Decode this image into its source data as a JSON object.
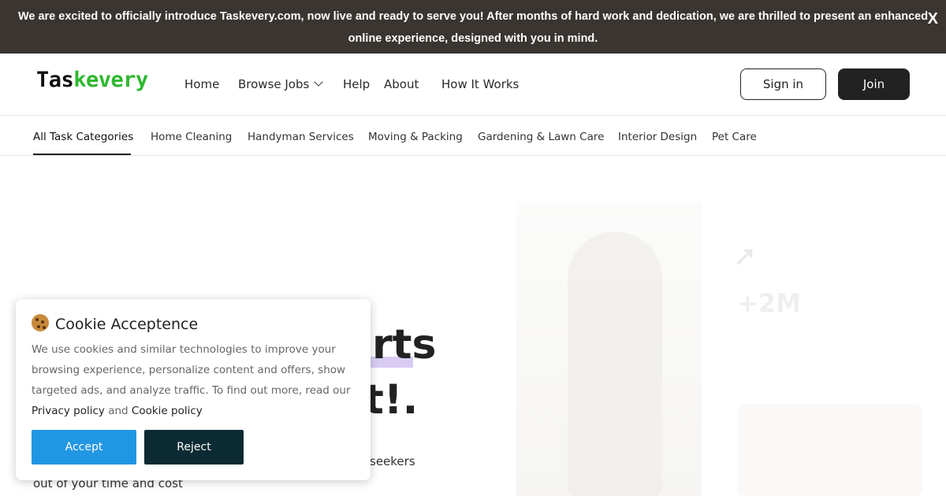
{
  "announcement": {
    "text": "We are excited to officially introduce Taskevery.com, now live and ready to serve you! After months of hard work and dedication, we are thrilled to present an enhanced online experience, designed with you in mind.",
    "close_label": "X"
  },
  "header": {
    "logo_part1": "Tas",
    "logo_part2": "kevery",
    "nav": {
      "home": "Home",
      "browse_jobs": "Browse Jobs",
      "help": "Help",
      "about": "About",
      "how_it_works": "How It Works"
    },
    "sign_in": "Sign in",
    "join": "Join"
  },
  "categories": [
    "All Task Categories",
    "Home Cleaning",
    "Handyman Services",
    "Moving & Packing",
    "Gardening & Lawn Care",
    "Interior Design",
    "Pet Care"
  ],
  "hero": {
    "title_line1_visible": "rts",
    "title_line2_visible": "t!.",
    "subtitle_right_visible": "seekers",
    "subtitle_line2": "out of your time and cost",
    "stat_number": "+2M"
  },
  "cookie": {
    "title": "Cookie Acceptence",
    "text": "We use cookies and similar technologies to improve your browsing experience, personalize content and offers, show targeted ads, and analyze traffic. To find out more, read our",
    "privacy_link": "Privacy policy",
    "and_text": "and",
    "cookie_link": "Cookie policy",
    "accept": "Accept",
    "reject": "Reject"
  },
  "colors": {
    "announcement_bg": "#3a3530",
    "logo_accent": "#2eb82e",
    "accept_button": "#2196e3",
    "reject_button": "#0c2a33",
    "join_button": "#222222",
    "title_highlight": "#d8ccf4"
  }
}
